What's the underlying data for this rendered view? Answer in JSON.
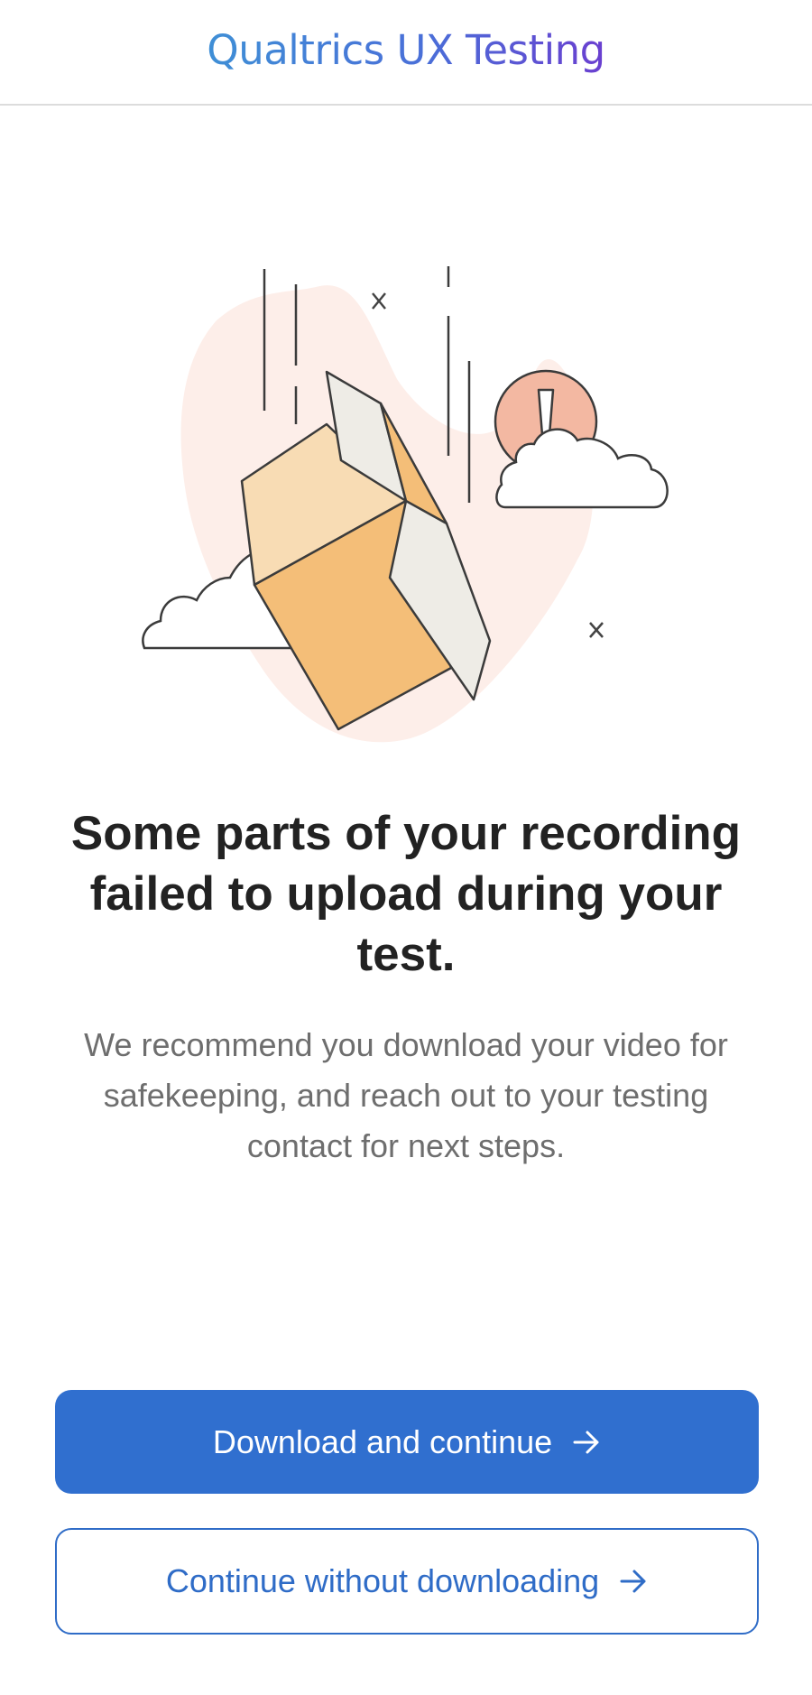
{
  "header": {
    "brand": "Qualtrics UX Testing"
  },
  "illustration": {
    "depicts": [
      "falling-box-icon",
      "cloud-icon",
      "alert-icon",
      "close-icon"
    ]
  },
  "message": {
    "title": "Some parts of your recording failed to upload during your test.",
    "body": "We recommend you download your video for safekeeping, and reach out to your testing contact for next steps."
  },
  "actions": {
    "primary_label": "Download and continue",
    "secondary_label": "Continue without downloading",
    "icon": "arrow-right-icon"
  },
  "colors": {
    "primary": "#306fcf",
    "secondary_text": "#2f6cc7",
    "title": "#222222",
    "body": "#6e6e6e",
    "box_light": "#f8dcb4",
    "box_dark": "#f4be78",
    "alert": "#f3b8a2",
    "blob": "#fdeee9"
  }
}
